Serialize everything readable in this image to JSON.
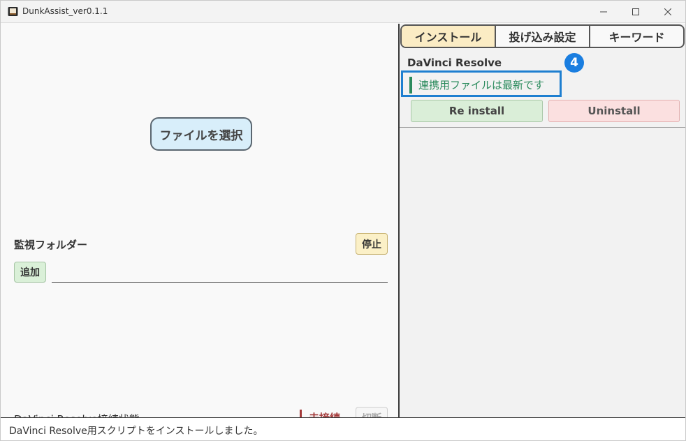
{
  "window": {
    "title": "DunkAssist_ver0.1.1",
    "icon": "app-icon",
    "controls": {
      "minimize": "–",
      "maximize": "☐",
      "close": "✕"
    }
  },
  "left": {
    "select_file_label": "ファイルを選択",
    "watch_folder_label": "監視フォルダー",
    "stop_label": "停止",
    "add_label": "追加",
    "folder_input_value": "",
    "connection_label": "DaVinci Resolve接続状態",
    "connection_status": "未接続",
    "disconnect_label": "切断"
  },
  "right": {
    "tabs": [
      {
        "label": "インストール",
        "active": true
      },
      {
        "label": "投げ込み設定",
        "active": false
      },
      {
        "label": "キーワード",
        "active": false
      }
    ],
    "resolve_title": "DaVinci Resolve",
    "badge": "4",
    "file_status": "連携用ファイルは最新です",
    "reinstall_label": "Re install",
    "uninstall_label": "Uninstall"
  },
  "statusbar": {
    "message": "DaVinci Resolve用スクリプトをインストールしました。"
  },
  "colors": {
    "accent_blue": "#1e7fd0",
    "status_green": "#2a8a5c",
    "status_red": "#a33a3a",
    "tab_active": "#fbecc4"
  }
}
